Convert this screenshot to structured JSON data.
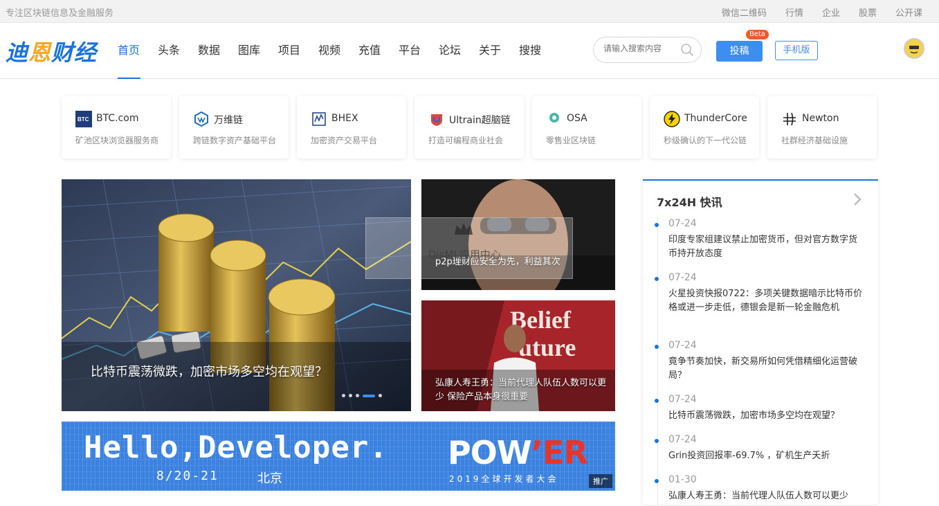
{
  "topbar": {
    "slogan": "专注区块链信息及金融服务",
    "links": [
      "微信二维码",
      "行情",
      "企业",
      "股票",
      "公开课"
    ]
  },
  "header": {
    "logo_main": "迪",
    "logo_accent": "恩",
    "logo_rest": "财经",
    "nav": [
      "首页",
      "头条",
      "数据",
      "图库",
      "项目",
      "视频",
      "充值",
      "平台",
      "论坛",
      "关于",
      "搜搜"
    ],
    "active_nav": "首页",
    "search_placeholder": "请输入搜索内容",
    "submit_label": "投稿",
    "beta_label": "Beta",
    "mobile_label": "手机版"
  },
  "partners": [
    {
      "name": "BTC.com",
      "desc": "矿池区块浏览器服务商",
      "icon": "btc-logo-icon"
    },
    {
      "name": "万维链",
      "desc": "跨链数字资产基础平台",
      "icon": "wanchain-logo-icon"
    },
    {
      "name": "BHEX",
      "desc": "加密资产交易平台",
      "icon": "bhex-logo-icon"
    },
    {
      "name": "Ultrain超脑链",
      "desc": "打造可编程商业社会",
      "icon": "ultrain-logo-icon"
    },
    {
      "name": "OSA",
      "desc": "零售业区块链",
      "icon": "osa-logo-icon"
    },
    {
      "name": "ThunderCore",
      "desc": "秒级确认的下一代公链",
      "icon": "thundercore-logo-icon"
    },
    {
      "name": "Newton",
      "desc": "社群经济基础设施",
      "icon": "newton-logo-icon"
    }
  ],
  "carousel": {
    "caption": "比特币震荡微跌，加密市场多空均在观望？",
    "slide_count": 4,
    "active_slide": 4
  },
  "cards": [
    {
      "caption": "p2p理财应安全为先，利益其次"
    },
    {
      "caption": "弘康人寿王勇：当前代理人队伍人数可以更少 保险产品本身很重要"
    }
  ],
  "watermark": "DisML应用中心",
  "banner": {
    "headline": "Hello,Developer.",
    "date": "8/20-21",
    "city": "北京",
    "brand_pre": "POW",
    "brand_apos": "’",
    "brand_post": "ER",
    "sub": "2019全球开发者大会",
    "ad_tag": "推广"
  },
  "flash": {
    "title": "7x24H 快讯",
    "items": [
      {
        "date": "07-24",
        "text": "印度专家组建议禁止加密货币，但对官方数字货币持开放态度"
      },
      {
        "date": "07-24",
        "text": "火星投资快报0722：多项关键数据暗示比特币价格或进一步走低，德银会是新一轮金融危机"
      },
      {
        "date": "07-24",
        "text": "竟争节奏加快，新交易所如何凭借精细化运营破局？"
      },
      {
        "date": "07-24",
        "text": "比特币震荡微跌，加密市场多空均在观望？"
      },
      {
        "date": "07-24",
        "text": "Grin投资回报率-69.7% ，矿机生产夭折"
      },
      {
        "date": "01-30",
        "text": "弘康人寿王勇：当前代理人队伍人数可以更少"
      }
    ]
  },
  "colors": {
    "brand_blue": "#1a73d9",
    "button_blue": "#3c8ef0",
    "beta_red": "#ef5a2c"
  }
}
